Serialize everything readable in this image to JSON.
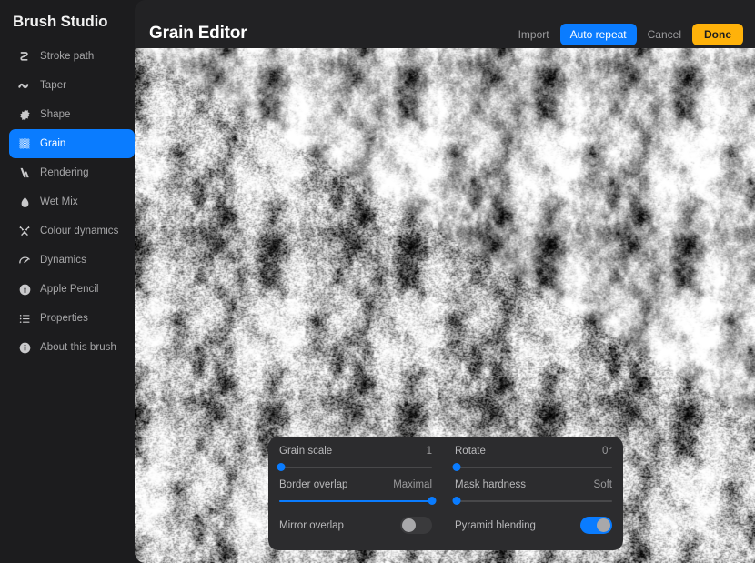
{
  "sidebar": {
    "title": "Brush Studio",
    "items": [
      {
        "label": "Stroke path",
        "icon": "stroke-path-icon",
        "active": false
      },
      {
        "label": "Taper",
        "icon": "taper-icon",
        "active": false
      },
      {
        "label": "Shape",
        "icon": "shape-icon",
        "active": false
      },
      {
        "label": "Grain",
        "icon": "grain-icon",
        "active": true
      },
      {
        "label": "Rendering",
        "icon": "rendering-icon",
        "active": false
      },
      {
        "label": "Wet Mix",
        "icon": "droplet-icon",
        "active": false
      },
      {
        "label": "Colour dynamics",
        "icon": "colour-dynamics-icon",
        "active": false
      },
      {
        "label": "Dynamics",
        "icon": "gauge-icon",
        "active": false
      },
      {
        "label": "Apple Pencil",
        "icon": "apple-pencil-icon",
        "active": false
      },
      {
        "label": "Properties",
        "icon": "list-icon",
        "active": false
      },
      {
        "label": "About this brush",
        "icon": "info-icon",
        "active": false
      }
    ]
  },
  "header": {
    "title": "Grain Editor",
    "import_label": "Import",
    "auto_repeat_label": "Auto repeat",
    "cancel_label": "Cancel",
    "done_label": "Done"
  },
  "controls": {
    "sliders": [
      {
        "label": "Grain scale",
        "value": "1",
        "percent": 1
      },
      {
        "label": "Rotate",
        "value": "0°",
        "percent": 1
      },
      {
        "label": "Border overlap",
        "value": "Maximal",
        "percent": 100
      },
      {
        "label": "Mask hardness",
        "value": "Soft",
        "percent": 1
      }
    ],
    "toggles": [
      {
        "label": "Mirror overlap",
        "on": false
      },
      {
        "label": "Pyramid blending",
        "on": true
      }
    ]
  },
  "colors": {
    "accent_blue": "#0a7cff",
    "accent_amber": "#ffb20a",
    "sidebar_bg": "#1c1c1e",
    "panel_bg": "#2c2c2e",
    "main_bg": "#222224"
  },
  "texture": {
    "description": "grayscale-grunge-grain-preview"
  }
}
